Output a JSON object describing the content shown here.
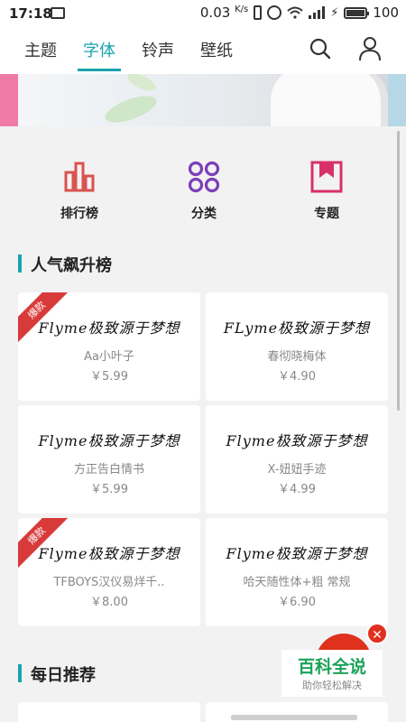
{
  "status_bar": {
    "time": "17:18",
    "speed": "0.03",
    "speed_unit": "K/s",
    "battery": "100",
    "battery_level": 1.0
  },
  "nav": {
    "tabs": [
      "主题",
      "字体",
      "铃声",
      "壁纸"
    ],
    "active_tab": "字体"
  },
  "categories": [
    {
      "label": "排行榜",
      "icon": "bar-chart-icon"
    },
    {
      "label": "分类",
      "icon": "grid-circles-icon"
    },
    {
      "label": "专题",
      "icon": "bookmark-frame-icon"
    }
  ],
  "colors": {
    "accent": "#1aa3b0",
    "ranking_icon": "#d9534f",
    "category_icon": "#7b3fb8",
    "topic_icon": "#d8306b",
    "hot_badge": "#d83a3a"
  },
  "sections": {
    "popular_title": "人气飙升榜",
    "daily_title": "每日推荐"
  },
  "fonts": [
    {
      "sample": "Flyme极致源于梦想",
      "name": "Aa小叶子",
      "price": "￥5.99",
      "badge": "爆款"
    },
    {
      "sample": "FLyme极致源于梦想",
      "name": "春彻晓梅体",
      "price": "￥4.90",
      "badge": ""
    },
    {
      "sample": "Flyme极致源于梦想",
      "name": "方正告白情书",
      "price": "￥5.99",
      "badge": ""
    },
    {
      "sample": "Flyme极致源于梦想",
      "name": "X-妞妞手迹",
      "price": "￥4.99",
      "badge": ""
    },
    {
      "sample": "Flyme极致源于梦想",
      "name": "TFBOYS汉仪易烊千..",
      "price": "￥8.00",
      "badge": "爆款"
    },
    {
      "sample": "Flyme极致源于梦想",
      "name": "哈天随性体+粗 常规",
      "price": "￥6.90",
      "badge": ""
    }
  ],
  "overlay": {
    "title": "百科全说",
    "subtitle": "助你轻松解决",
    "close": "✕"
  }
}
